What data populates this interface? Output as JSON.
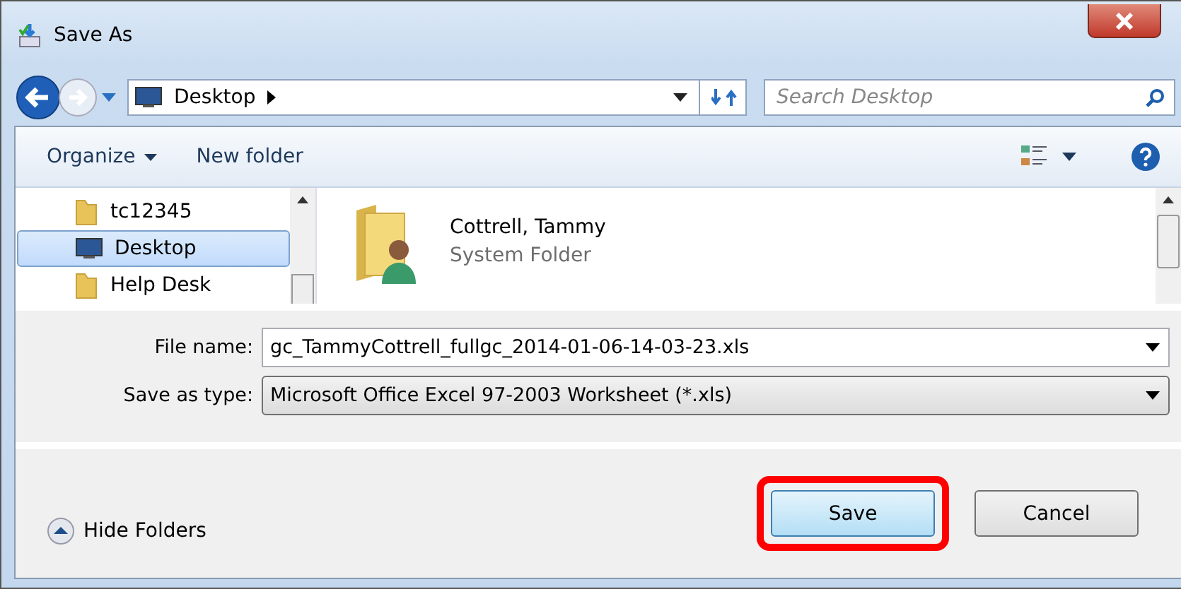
{
  "window": {
    "title": "Save As"
  },
  "address": {
    "location": "Desktop"
  },
  "search": {
    "placeholder": "Search Desktop"
  },
  "toolbar": {
    "buttons": [
      {
        "label": "Organize",
        "kind": "menu"
      },
      {
        "label": "New folder",
        "kind": "plain"
      }
    ]
  },
  "nav_tree": {
    "items": [
      {
        "label": "tc12345",
        "kind": "folder",
        "selected": false
      },
      {
        "label": "Desktop",
        "kind": "desktop",
        "selected": true
      },
      {
        "label": "Help Desk",
        "kind": "folder",
        "selected": false
      }
    ]
  },
  "files": [
    {
      "name": "Cottrell, Tammy",
      "type": "System Folder"
    }
  ],
  "form": {
    "file_name_label": "File name:",
    "file_name": "gc_TammyCottrell_fullgc_2014-01-06-14-03-23.xls",
    "type_label": "Save as type:",
    "save_as_type": "Microsoft Office Excel 97-2003 Worksheet (*.xls)"
  },
  "hide_folders": "Hide Folders",
  "buttons": [
    {
      "label": "Save",
      "default": true,
      "highlighted": true
    },
    {
      "label": "Cancel",
      "default": false,
      "highlighted": false
    }
  ]
}
